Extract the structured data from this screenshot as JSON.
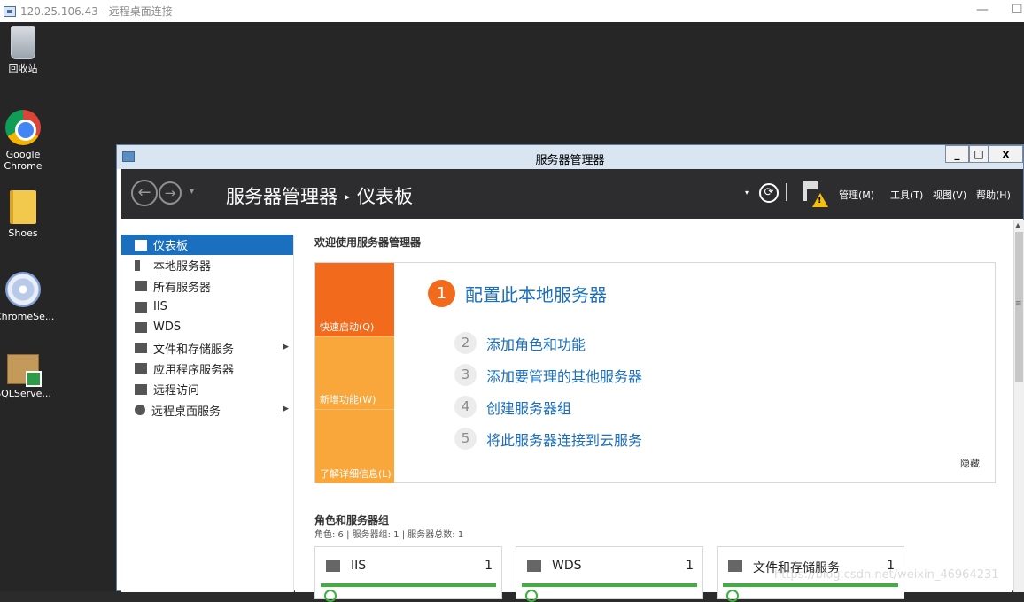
{
  "rdp": {
    "title": "120.25.106.43 - 远程桌面连接",
    "minimize_glyph": "—",
    "maximize_glyph": "☐"
  },
  "desktop": {
    "icons": [
      {
        "label": "回收站",
        "icon": "recycle-bin-icon"
      },
      {
        "label": "Google Chrome",
        "icon": "chrome-icon"
      },
      {
        "label": "Shoes",
        "icon": "folder-icon"
      },
      {
        "label": "ChromeSe...",
        "icon": "cd-setup-icon"
      },
      {
        "label": "SQLServe...",
        "icon": "package-icon"
      }
    ]
  },
  "window": {
    "title": "服务器管理器",
    "minimize_glyph": "_",
    "maximize_glyph": "□",
    "close_glyph": "x"
  },
  "header": {
    "back_glyph": "←",
    "forward_glyph": "→",
    "dropdown_glyph": "▾",
    "breadcrumb_root": "服务器管理器",
    "breadcrumb_sep": "▸",
    "breadcrumb_current": "仪表板",
    "refresh_glyph": "⟳",
    "warn_glyph": "!",
    "menus": [
      "管理(M)",
      "工具(T)",
      "视图(V)",
      "帮助(H)"
    ]
  },
  "sidebar": {
    "items": [
      {
        "label": "仪表板",
        "icon": "dashboard-icon",
        "active": true,
        "submenu": false
      },
      {
        "label": "本地服务器",
        "icon": "local-server-icon",
        "active": false,
        "submenu": false
      },
      {
        "label": "所有服务器",
        "icon": "all-servers-icon",
        "active": false,
        "submenu": false
      },
      {
        "label": "IIS",
        "icon": "iis-icon",
        "active": false,
        "submenu": false
      },
      {
        "label": "WDS",
        "icon": "wds-icon",
        "active": false,
        "submenu": false
      },
      {
        "label": "文件和存储服务",
        "icon": "file-storage-icon",
        "active": false,
        "submenu": true
      },
      {
        "label": "应用程序服务器",
        "icon": "app-server-icon",
        "active": false,
        "submenu": false
      },
      {
        "label": "远程访问",
        "icon": "remote-access-icon",
        "active": false,
        "submenu": false
      },
      {
        "label": "远程桌面服务",
        "icon": "remote-desktop-icon",
        "active": false,
        "submenu": true
      }
    ],
    "submenu_glyph": "▶"
  },
  "welcome": {
    "title": "欢迎使用服务器管理器",
    "tiles": [
      "快速启动(Q)",
      "新增功能(W)",
      "了解详细信息(L)"
    ],
    "steps": [
      {
        "num": "1",
        "label": "配置此本地服务器"
      },
      {
        "num": "2",
        "label": "添加角色和功能"
      },
      {
        "num": "3",
        "label": "添加要管理的其他服务器"
      },
      {
        "num": "4",
        "label": "创建服务器组"
      },
      {
        "num": "5",
        "label": "将此服务器连接到云服务"
      }
    ],
    "hide_label": "隐藏"
  },
  "roles": {
    "title": "角色和服务器组",
    "summary": "角色: 6 | 服务器组: 1 | 服务器总数: 1",
    "cards": [
      {
        "name": "IIS",
        "count": "1",
        "icon": "iis-icon"
      },
      {
        "name": "WDS",
        "count": "1",
        "icon": "wds-icon"
      },
      {
        "name": "文件和存储服务",
        "count": "1",
        "icon": "file-storage-icon"
      }
    ]
  },
  "scrollbar": {
    "up_glyph": "▲",
    "grip_glyph": "≡"
  },
  "watermark": "https://blog.csdn.net/weixin_46964231",
  "colors": {
    "accent": "#1a6fbf",
    "quick_start": "#f26b1d",
    "tile": "#f9a63a",
    "header": "#2d2d30",
    "status_ok": "#3db03d"
  }
}
